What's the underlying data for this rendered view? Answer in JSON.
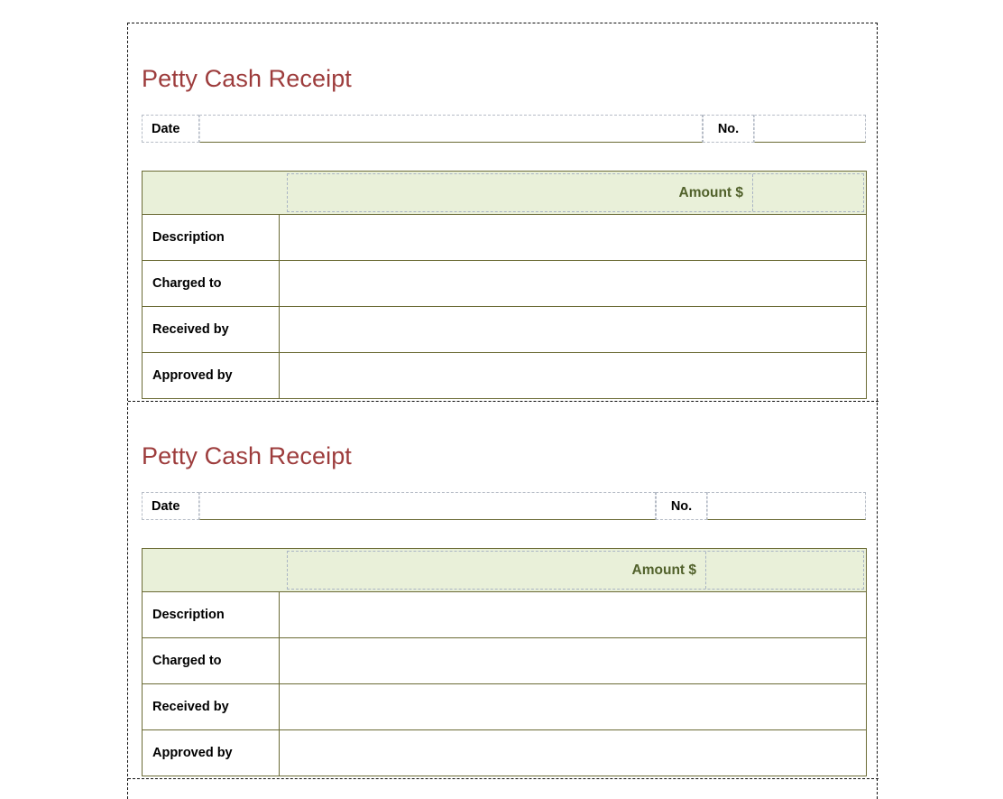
{
  "document": {
    "type": "petty-cash-receipt-form",
    "accent_title_color": "#9d3c3c",
    "table_border_color": "#6b6b35",
    "header_fill_color": "#e9f0d9",
    "amount_label_color": "#51612b",
    "grid_dotted_color": "#b6bcc6"
  },
  "receipts": [
    {
      "title": "Petty Cash Receipt",
      "date_label": "Date",
      "date_value": "",
      "no_label": "No.",
      "no_value": "",
      "amount_header": "Amount  $",
      "rows": [
        {
          "label": "Description",
          "value": ""
        },
        {
          "label": "Charged to",
          "value": ""
        },
        {
          "label": "Received by",
          "value": ""
        },
        {
          "label": "Approved by",
          "value": ""
        }
      ]
    },
    {
      "title": "Petty Cash Receipt",
      "date_label": "Date",
      "date_value": "",
      "no_label": "No.",
      "no_value": "",
      "amount_header": "Amount  $",
      "rows": [
        {
          "label": "Description",
          "value": ""
        },
        {
          "label": "Charged to",
          "value": ""
        },
        {
          "label": "Received by",
          "value": ""
        },
        {
          "label": "Approved by",
          "value": ""
        }
      ]
    }
  ]
}
